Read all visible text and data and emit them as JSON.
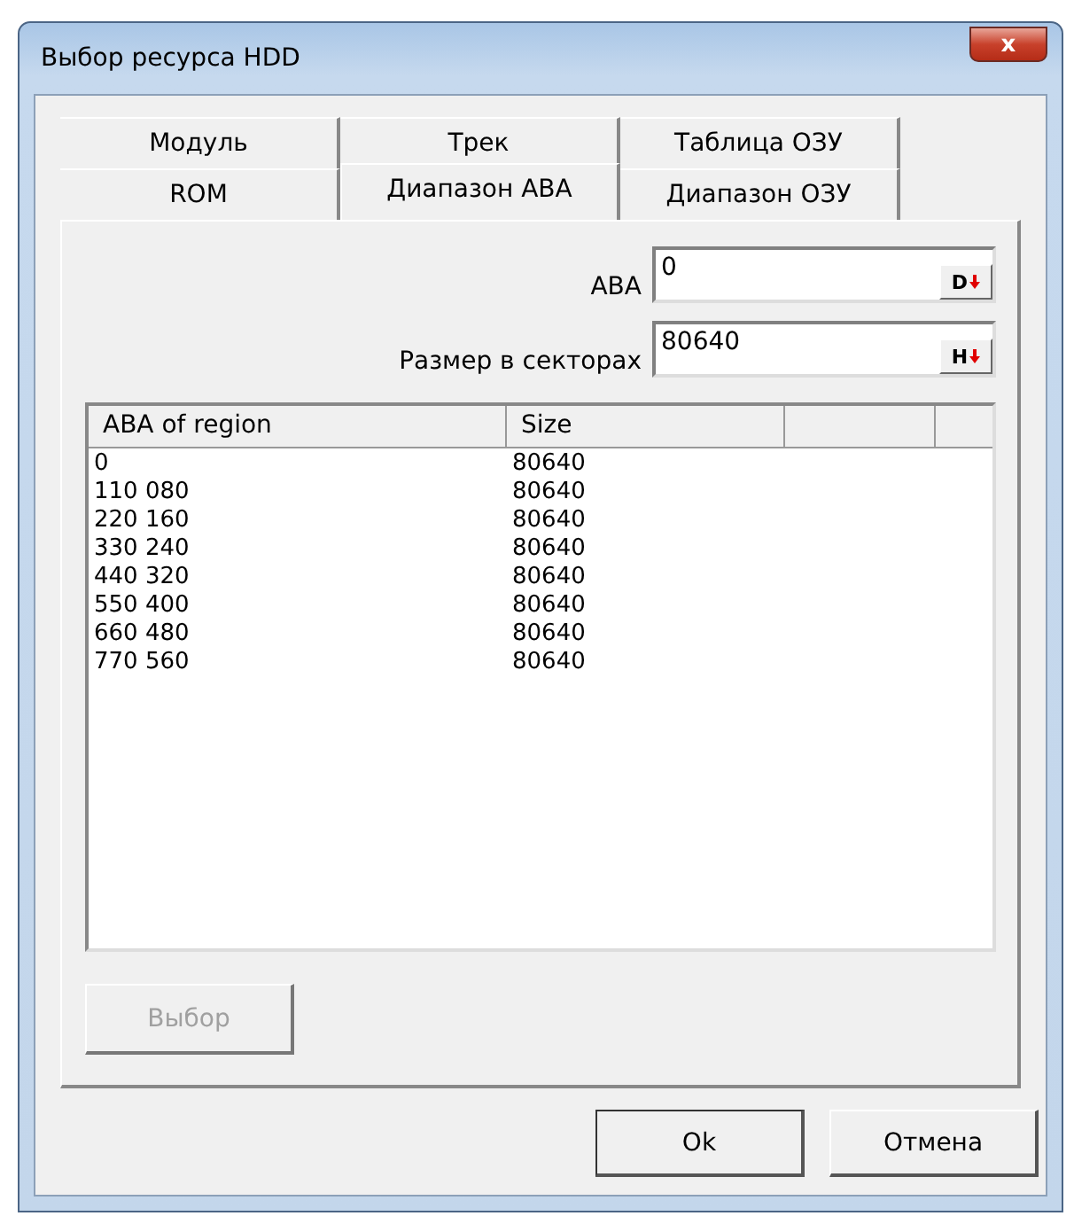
{
  "window": {
    "title": "Выбор ресурса HDD",
    "close": "x"
  },
  "tabs": [
    [
      {
        "label": "Модуль",
        "selected": false
      },
      {
        "label": "Трек",
        "selected": false
      },
      {
        "label": "Таблица ОЗУ",
        "selected": false
      }
    ],
    [
      {
        "label": "ROM",
        "selected": false
      },
      {
        "label": "Диапазон ABA",
        "selected": true
      },
      {
        "label": "Диапазон ОЗУ",
        "selected": false
      }
    ]
  ],
  "fields": [
    {
      "label": "ABA",
      "value": "0",
      "button": "D"
    },
    {
      "label": "Размер в секторах",
      "value": "80640",
      "button": "H"
    }
  ],
  "table": {
    "columns": [
      "ABA of region",
      "Size"
    ],
    "rows": [
      [
        "0",
        "80640"
      ],
      [
        "110 080",
        "80640"
      ],
      [
        "220 160",
        "80640"
      ],
      [
        "330 240",
        "80640"
      ],
      [
        "440 320",
        "80640"
      ],
      [
        "550 400",
        "80640"
      ],
      [
        "660 480",
        "80640"
      ],
      [
        "770 560",
        "80640"
      ]
    ]
  },
  "select_button": {
    "label": "Выбор",
    "disabled": true
  },
  "buttons": [
    "Ok",
    "Отмена"
  ]
}
